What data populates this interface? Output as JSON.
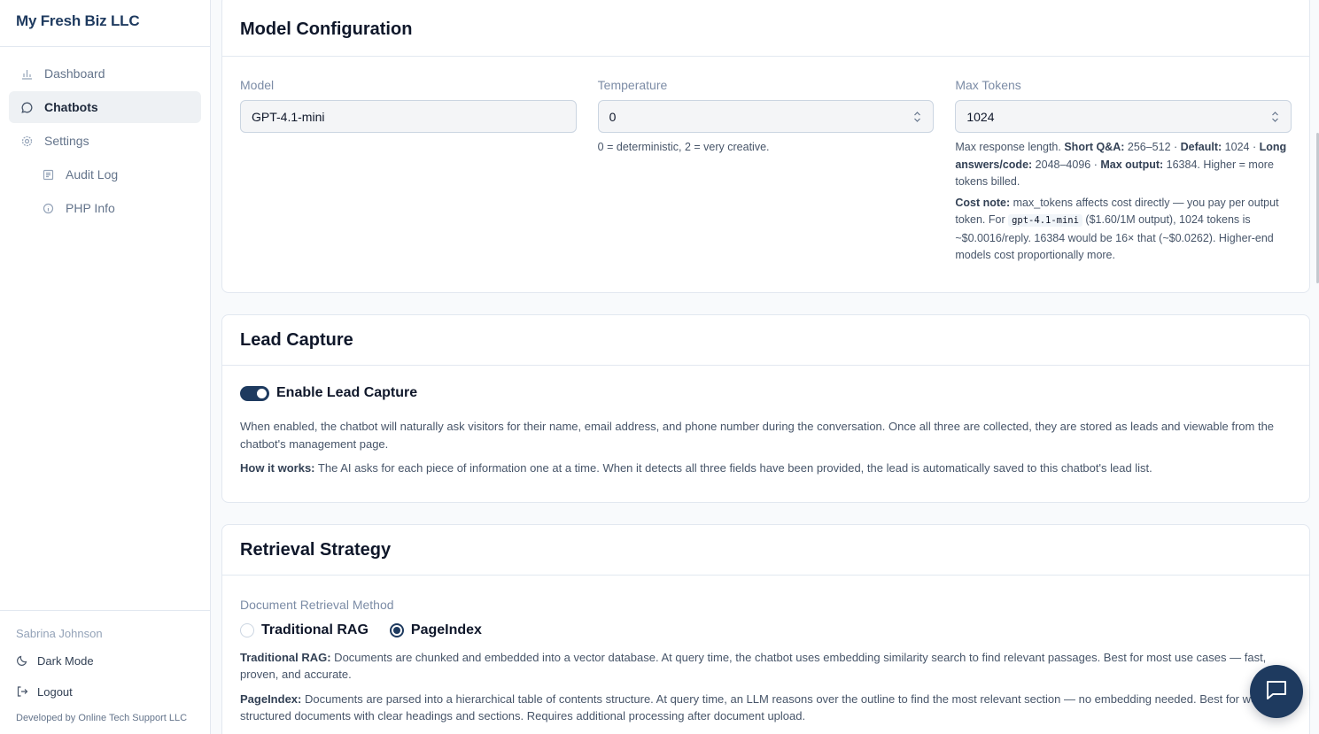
{
  "sidebar": {
    "brand": "My Fresh Biz LLC",
    "items": [
      {
        "label": "Dashboard"
      },
      {
        "label": "Chatbots"
      },
      {
        "label": "Settings"
      },
      {
        "label": "Audit Log"
      },
      {
        "label": "PHP Info"
      }
    ],
    "footer": {
      "user": "Sabrina Johnson",
      "dark_mode": "Dark Mode",
      "logout": "Logout",
      "developer": "Developed by Online Tech Support LLC"
    }
  },
  "model_config": {
    "title": "Model Configuration",
    "model": {
      "label": "Model",
      "value": "GPT-4.1-mini"
    },
    "temperature": {
      "label": "Temperature",
      "value": "0",
      "hint": "0 = deterministic, 2 = very creative."
    },
    "max_tokens": {
      "label": "Max Tokens",
      "value": "1024",
      "hint1": {
        "a": "Max response length. ",
        "b": "Short Q&A:",
        "c": " 256–512 · ",
        "d": "Default:",
        "e": " 1024 · ",
        "f": "Long answers/code:",
        "g": " 2048–4096 · ",
        "h": "Max output:",
        "i": " 16384. Higher = more tokens billed."
      },
      "hint2": {
        "a": "Cost note:",
        "b": " max_tokens affects cost directly — you pay per output token. For ",
        "code": "gpt-4.1-mini",
        "c": " ($1.60/1M output), 1024 tokens is ~$0.0016/reply. 16384 would be 16× that (~$0.0262). Higher-end models cost proportionally more."
      }
    }
  },
  "lead_capture": {
    "title": "Lead Capture",
    "toggle_label": "Enable Lead Capture",
    "toggle_on": true,
    "description": "When enabled, the chatbot will naturally ask visitors for their name, email address, and phone number during the conversation. Once all three are collected, they are stored as leads and viewable from the chatbot's management page.",
    "how_label": "How it works:",
    "how_text": " The AI asks for each piece of information one at a time. When it detects all three fields have been provided, the lead is automatically saved to this chatbot's lead list."
  },
  "retrieval": {
    "title": "Retrieval Strategy",
    "method_label": "Document Retrieval Method",
    "options": [
      {
        "label": "Traditional RAG",
        "selected": false
      },
      {
        "label": "PageIndex",
        "selected": true
      }
    ],
    "rag_label": "Traditional RAG:",
    "rag_text": " Documents are chunked and embedded into a vector database. At query time, the chatbot uses embedding similarity search to find relevant passages. Best for most use cases — fast, proven, and accurate.",
    "pi_label": "PageIndex:",
    "pi_text": " Documents are parsed into a hierarchical table of contents structure. At query time, an LLM reasons over the outline to find the most relevant section — no embedding needed. Best for well-structured documents with clear headings and sections. Requires additional processing after document upload."
  },
  "colors": {
    "accent": "#1e3a5f",
    "border": "#e2e8f0",
    "muted": "#64748b"
  }
}
